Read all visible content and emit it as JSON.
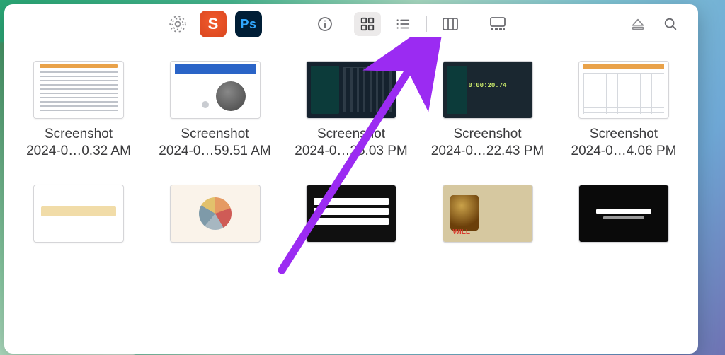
{
  "toolbar": {
    "apps": [
      {
        "name": "airdrop",
        "icon": "airdrop"
      },
      {
        "name": "app-s",
        "label": "S"
      },
      {
        "name": "photoshop",
        "label": "Ps"
      }
    ],
    "view_active": "icon"
  },
  "files": [
    {
      "id": "f1",
      "thumb": "doc",
      "name_line1": "Screenshot",
      "name_line2": "2024-0…0.32 AM"
    },
    {
      "id": "f2",
      "thumb": "product",
      "name_line1": "Screenshot",
      "name_line2": "2024-0…59.51 AM"
    },
    {
      "id": "f3",
      "thumb": "darkui",
      "name_line1": "Screenshot",
      "name_line2": "2024-0…25.03 PM"
    },
    {
      "id": "f4",
      "thumb": "timer",
      "name_line1": "Screenshot",
      "name_line2": "2024-0…22.43 PM"
    },
    {
      "id": "f5",
      "thumb": "sheet",
      "name_line1": "Screenshot",
      "name_line2": "2024-0…4.06 PM"
    },
    {
      "id": "f6",
      "thumb": "summary",
      "name_line1": "",
      "name_line2": ""
    },
    {
      "id": "f7",
      "thumb": "pie",
      "name_line1": "",
      "name_line2": ""
    },
    {
      "id": "f8",
      "thumb": "wealth",
      "name_line1": "",
      "name_line2": ""
    },
    {
      "id": "f9",
      "thumb": "will",
      "name_line1": "",
      "name_line2": ""
    },
    {
      "id": "f10",
      "thumb": "darkvid",
      "name_line1": "",
      "name_line2": ""
    }
  ],
  "annotation": {
    "color": "#9b2bf2",
    "target": "list-view-button"
  }
}
